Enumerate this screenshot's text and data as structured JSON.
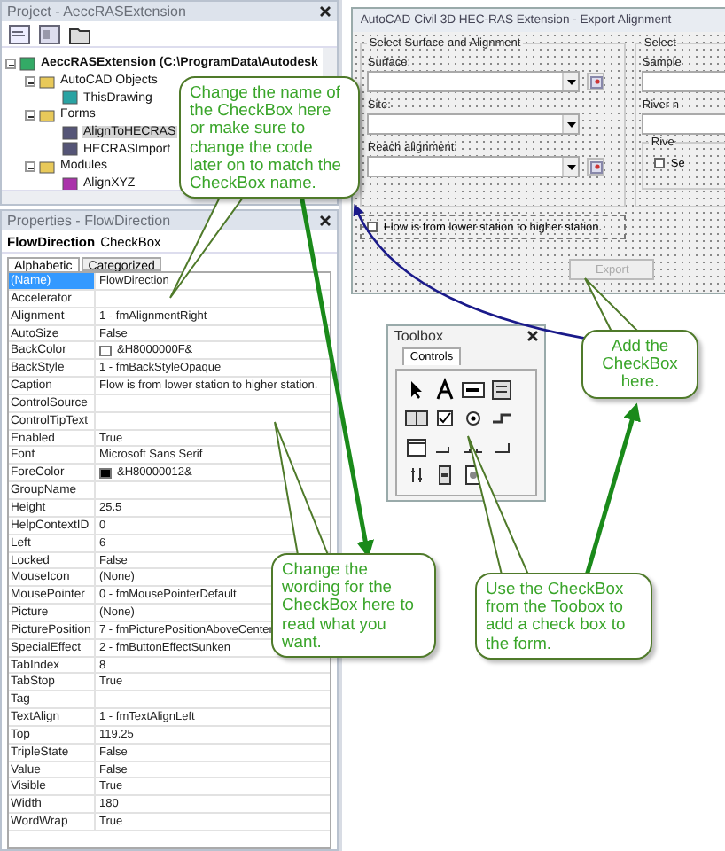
{
  "project": {
    "title": "Project - AeccRASExtension",
    "tree": [
      {
        "label": "AeccRASExtension (C:\\ProgramData\\Autodesk",
        "kind": "project",
        "expanded": true,
        "selected": false,
        "children": [
          {
            "label": "AutoCAD Objects",
            "kind": "folder",
            "expanded": true,
            "selected": false,
            "children": [
              {
                "label": "ThisDrawing",
                "kind": "drawing",
                "selected": false
              }
            ]
          },
          {
            "label": "Forms",
            "kind": "folder",
            "expanded": true,
            "selected": false,
            "children": [
              {
                "label": "AlignToHECRAS",
                "kind": "form",
                "selected": true
              },
              {
                "label": "HECRASImport",
                "kind": "form",
                "selected": false
              }
            ]
          },
          {
            "label": "Modules",
            "kind": "folder",
            "expanded": true,
            "selected": false,
            "children": [
              {
                "label": "AlignXYZ",
                "kind": "module",
                "selected": false
              }
            ]
          }
        ]
      }
    ]
  },
  "properties": {
    "title": "Properties - FlowDirection",
    "object_name": "FlowDirection",
    "object_type": "CheckBox",
    "tabs": [
      {
        "label": "Alphabetic",
        "selected": true
      },
      {
        "label": "Categorized",
        "selected": false
      }
    ],
    "rows": [
      {
        "name": "(Name)",
        "value": "FlowDirection",
        "selected": true
      },
      {
        "name": "Accelerator",
        "value": "",
        "selected": false
      },
      {
        "name": "Alignment",
        "value": "1 - fmAlignmentRight",
        "selected": false
      },
      {
        "name": "AutoSize",
        "value": "False",
        "selected": false
      },
      {
        "name": "BackColor",
        "value": "&H8000000F&",
        "selected": false,
        "color": "#ffffff"
      },
      {
        "name": "BackStyle",
        "value": "1 - fmBackStyleOpaque",
        "selected": false
      },
      {
        "name": "Caption",
        "value": "Flow is from lower station to higher station.",
        "selected": false
      },
      {
        "name": "ControlSource",
        "value": "",
        "selected": false
      },
      {
        "name": "ControlTipText",
        "value": "",
        "selected": false
      },
      {
        "name": "Enabled",
        "value": "True",
        "selected": false
      },
      {
        "name": "Font",
        "value": "Microsoft Sans Serif",
        "selected": false
      },
      {
        "name": "ForeColor",
        "value": "&H80000012&",
        "selected": false,
        "color": "#000000"
      },
      {
        "name": "GroupName",
        "value": "",
        "selected": false
      },
      {
        "name": "Height",
        "value": "25.5",
        "selected": false
      },
      {
        "name": "HelpContextID",
        "value": "0",
        "selected": false
      },
      {
        "name": "Left",
        "value": "6",
        "selected": false
      },
      {
        "name": "Locked",
        "value": "False",
        "selected": false
      },
      {
        "name": "MouseIcon",
        "value": "(None)",
        "selected": false
      },
      {
        "name": "MousePointer",
        "value": "0 - fmMousePointerDefault",
        "selected": false
      },
      {
        "name": "Picture",
        "value": "(None)",
        "selected": false
      },
      {
        "name": "PicturePosition",
        "value": "7 - fmPicturePositionAboveCenter",
        "selected": false
      },
      {
        "name": "SpecialEffect",
        "value": "2 - fmButtonEffectSunken",
        "selected": false
      },
      {
        "name": "TabIndex",
        "value": "8",
        "selected": false
      },
      {
        "name": "TabStop",
        "value": "True",
        "selected": false
      },
      {
        "name": "Tag",
        "value": "",
        "selected": false
      },
      {
        "name": "TextAlign",
        "value": "1 - fmTextAlignLeft",
        "selected": false
      },
      {
        "name": "Top",
        "value": "119.25",
        "selected": false
      },
      {
        "name": "TripleState",
        "value": "False",
        "selected": false
      },
      {
        "name": "Value",
        "value": "False",
        "selected": false
      },
      {
        "name": "Visible",
        "value": "True",
        "selected": false
      },
      {
        "name": "Width",
        "value": "180",
        "selected": false
      },
      {
        "name": "WordWrap",
        "value": "True",
        "selected": false
      }
    ]
  },
  "form_window": {
    "title": "AutoCAD Civil 3D HEC-RAS Extension - Export Alignment",
    "frame_title": "Select Surface and Alignment",
    "fields": [
      {
        "label": "Surface:",
        "pick_button": true
      },
      {
        "label": "Site:",
        "pick_button": false
      },
      {
        "label": "Reach alignment:",
        "pick_button": true
      }
    ],
    "checkbox": {
      "label": "Flow is from lower station to higher station.",
      "checked": false
    },
    "right_frame_title": "Select",
    "right_labels": [
      "Sample",
      "River n"
    ],
    "right_subframe_title": "Rive",
    "right_checkbox": {
      "label": "Se",
      "checked": false
    },
    "export_button": {
      "label": "Export",
      "disabled": true
    }
  },
  "toolbox": {
    "title": "Toolbox",
    "tabs": [
      {
        "label": "Controls",
        "selected": true
      }
    ]
  },
  "callouts": [
    {
      "text": "Change the name of the CheckBox here or make sure to change the code later on to match the CheckBox name."
    },
    {
      "text": "Change the wording for the CheckBox here to read what you want."
    },
    {
      "text": "Add the CheckBox here."
    },
    {
      "text": "Use the CheckBox from the Toobox to add a check box to the form."
    }
  ]
}
